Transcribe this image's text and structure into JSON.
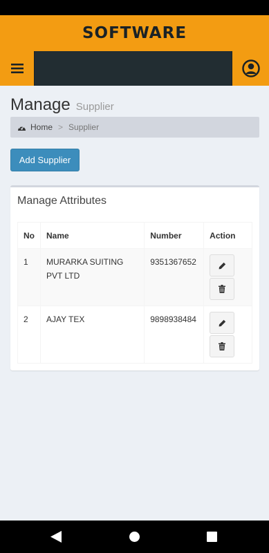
{
  "app": {
    "brand": "SOFTWARE"
  },
  "header": {
    "menu_icon": "hamburger-menu-icon",
    "user_icon": "user-circle-icon"
  },
  "page": {
    "title": "Manage",
    "subtitle": "Supplier"
  },
  "breadcrumb": {
    "home": "Home",
    "separator": ">",
    "current": "Supplier"
  },
  "actions": {
    "add_label": "Add Supplier"
  },
  "box": {
    "title": "Manage Attributes",
    "columns": [
      "No",
      "Name",
      "Number",
      "Action"
    ],
    "rows": [
      {
        "no": "1",
        "name": "MURARKA SUITING PVT LTD",
        "number": "9351367652"
      },
      {
        "no": "2",
        "name": "AJAY TEX",
        "number": "9898938484"
      }
    ]
  },
  "colors": {
    "brand": "#f39c12",
    "navbar": "#222d32",
    "primary": "#3c8dbc",
    "background": "#ecf0f5"
  }
}
